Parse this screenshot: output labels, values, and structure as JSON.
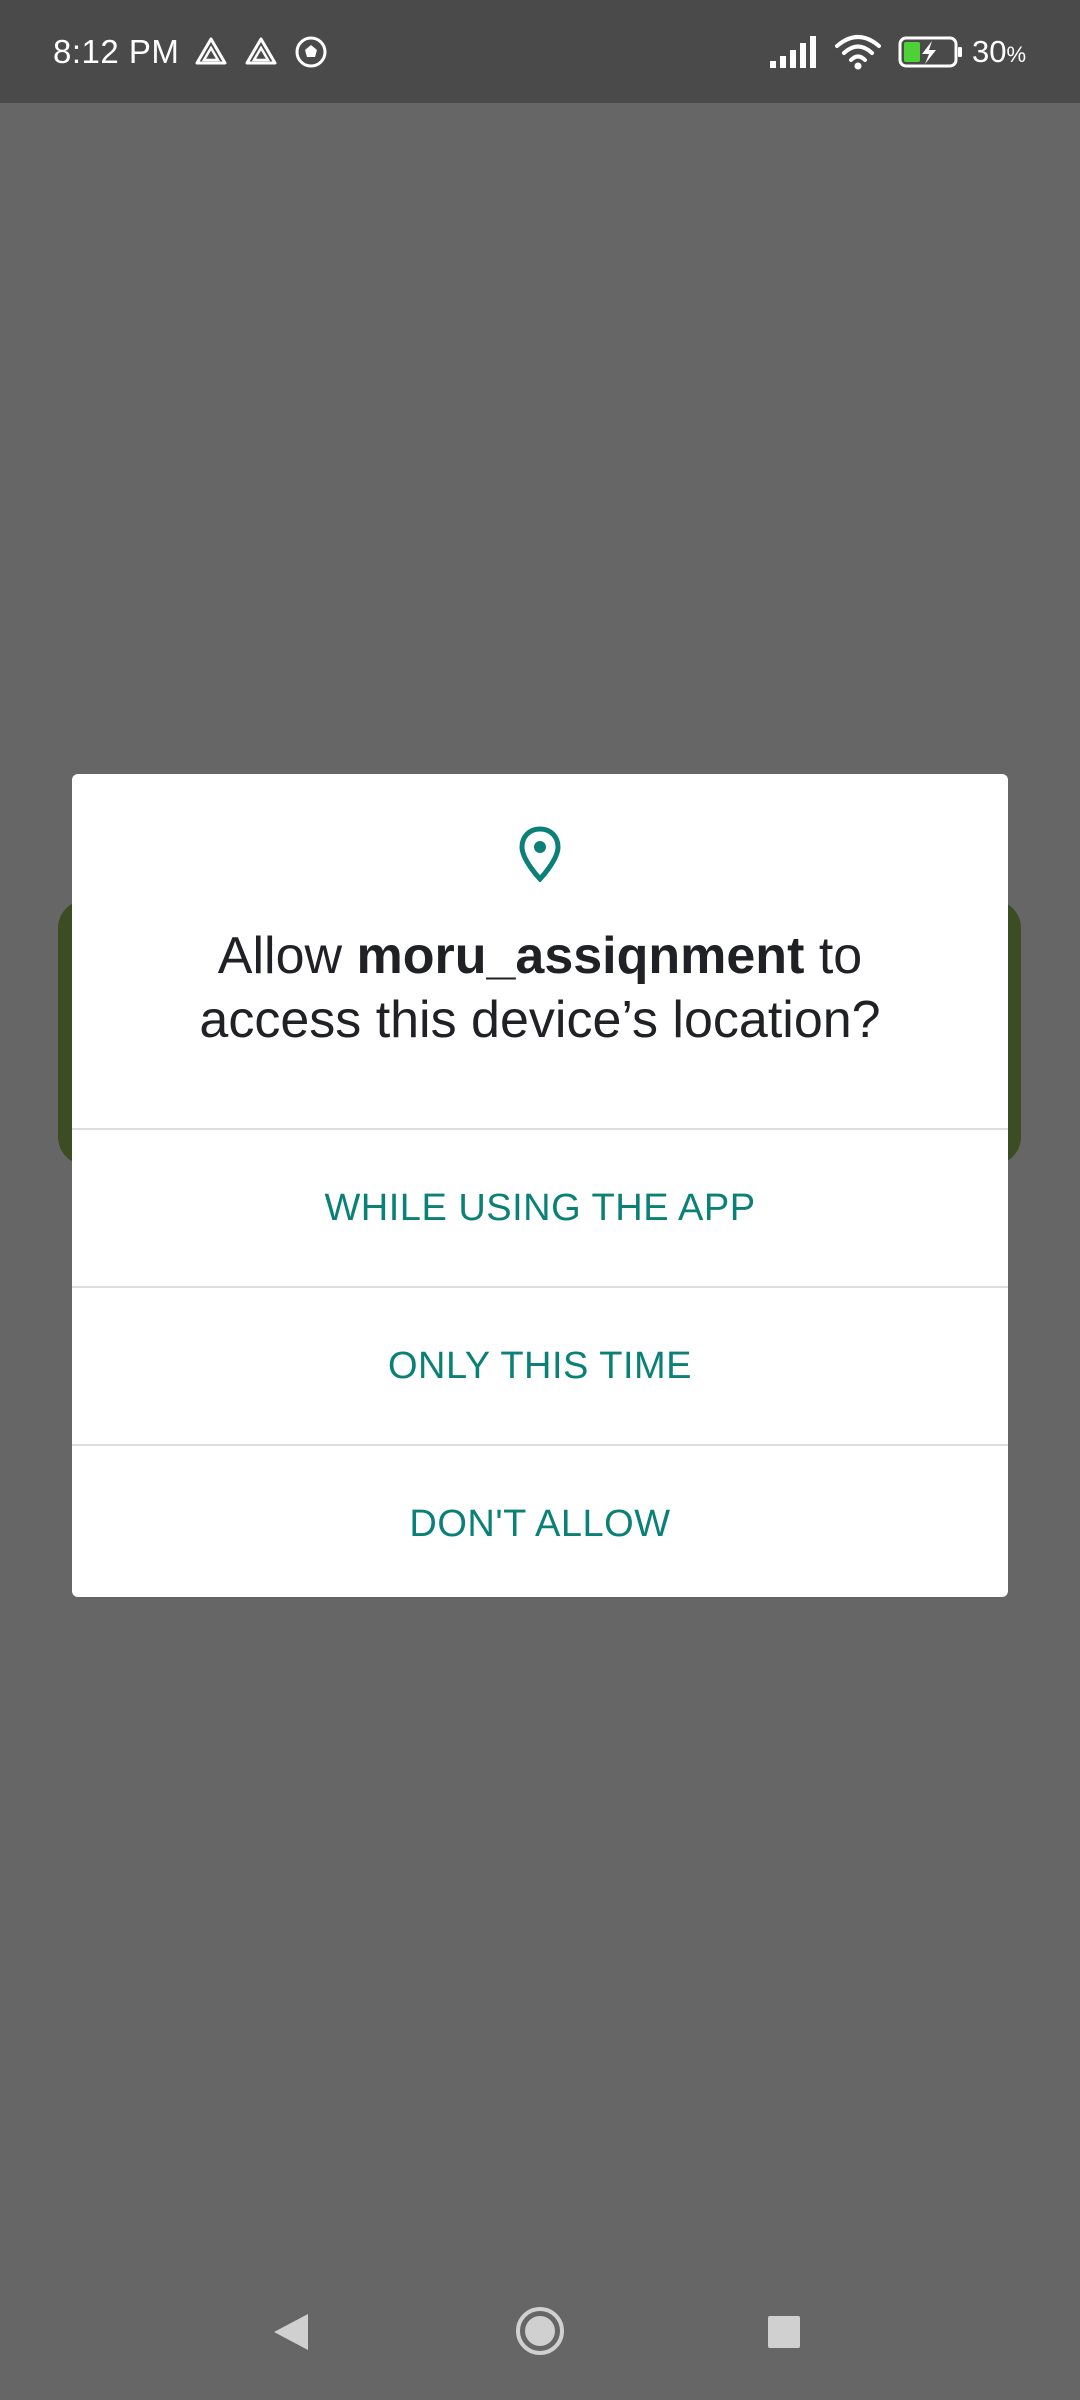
{
  "status_bar": {
    "time": "8:12 PM",
    "notification_icons": [
      "drive-icon",
      "drive-icon",
      "soccer-ball-icon"
    ],
    "battery_value": "30",
    "battery_unit": "%",
    "charging": true
  },
  "dialog": {
    "icon": "location-pin-icon",
    "title_prefix": "Allow ",
    "app_name": "moru_assiqnment",
    "title_middle": " to",
    "title_line2": "access this device’s location?",
    "options": [
      {
        "label": "WHILE USING THE APP"
      },
      {
        "label": "ONLY THIS TIME"
      },
      {
        "label": "DON'T ALLOW"
      }
    ]
  },
  "colors": {
    "accent": "#0b8076",
    "scrim": "#666666",
    "status_bar": "#4a4a4a",
    "battery_fill": "#4cd137"
  },
  "nav_bar": {
    "buttons": [
      "back-icon",
      "home-icon",
      "recents-icon"
    ]
  }
}
